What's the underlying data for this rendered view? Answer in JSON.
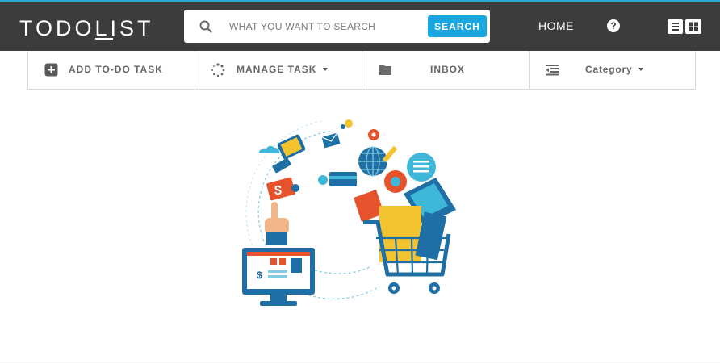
{
  "header": {
    "logo": "TODOLIST",
    "search": {
      "placeholder": "WHAT YOU WANT TO SEARCH",
      "button_label": "SEARCH"
    },
    "nav": {
      "home_label": "HOME",
      "help_glyph": "?"
    }
  },
  "toolbar": {
    "add_task": "ADD TO-DO TASK",
    "manage_task": "MANAGE TASK",
    "inbox": "INBOX",
    "category": "Category"
  },
  "colors": {
    "header_bg": "#3c3c3c",
    "accent": "#1aa7e0"
  },
  "icons": [
    "search-icon",
    "help-icon",
    "list-view-icon",
    "grid-view-icon",
    "plus-square-icon",
    "spinner-icon",
    "folder-icon",
    "outdent-icon"
  ]
}
